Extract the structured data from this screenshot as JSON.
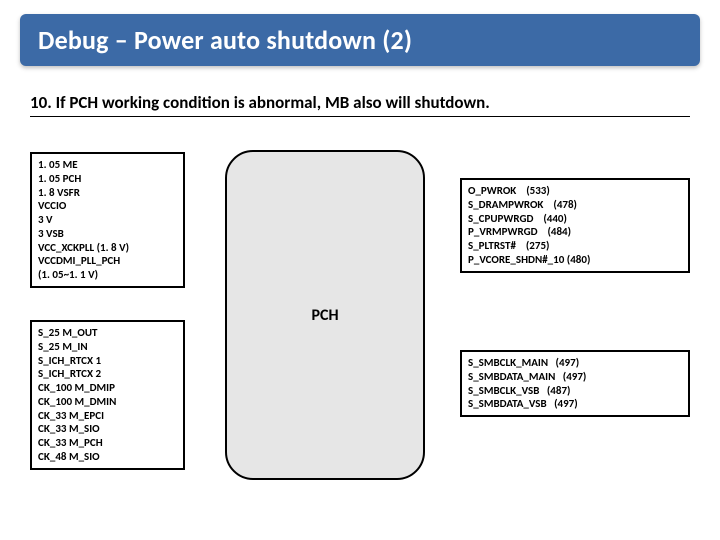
{
  "title": "Debug – Power auto shutdown (2)",
  "subtitle": "10. If  PCH working condition is abnormal, MB also will shutdown.",
  "pch_label": "PCH",
  "boxes": {
    "top_left": "1. 05 ME\n1. 05 PCH\n1. 8 VSFR\nVCCIO\n3 V\n3 VSB\nVCC_XCKPLL (1. 8 V)\nVCCDMI_PLL_PCH\n(1. 05~1. 1 V)",
    "bottom_left": "S_25 M_OUT\nS_25 M_IN\nS_ICH_RTCX 1\nS_ICH_RTCX 2\nCK_100 M_DMIP\nCK_100 M_DMIN\nCK_33 M_EPCI\nCK_33 M_SIO\nCK_33 M_PCH\nCK_48 M_SIO",
    "top_right": "O_PWROK    (533)\nS_DRAMPWROK    (478)\nS_CPUPWRGD    (440)\nP_VRMPWRGD    (484)\nS_PLTRST#    (275)\nP_VCORE_SHDN#_10 (480)",
    "bottom_right": "S_SMBCLK_MAIN   (497)\nS_SMBDATA_MAIN   (497)\nS_SMBCLK_VSB   (487)\nS_SMBDATA_VSB   (497)"
  }
}
